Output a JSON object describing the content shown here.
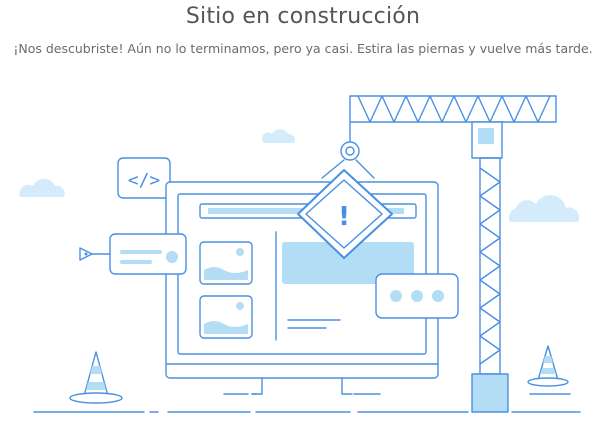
{
  "page": {
    "title": "Sitio en construcción",
    "subtitle": "¡Nos descubriste! Aún no lo terminamos, pero ya casi. Estira las piernas y vuelve más tarde."
  },
  "illustration": {
    "code_icon_text": "</>",
    "warning_sign_text": "!",
    "colors": {
      "outline": "#4a90e2",
      "fill": "#b3dcf5",
      "cloud": "#d3ebfa",
      "ground": "#4a90e2"
    },
    "icons": [
      "cloud-icon",
      "code-tag-icon",
      "pen-tool-icon",
      "monitor-icon",
      "image-placeholder-icon",
      "warning-sign-icon",
      "chat-bubble-icon",
      "crane-icon",
      "traffic-cone-icon"
    ]
  }
}
